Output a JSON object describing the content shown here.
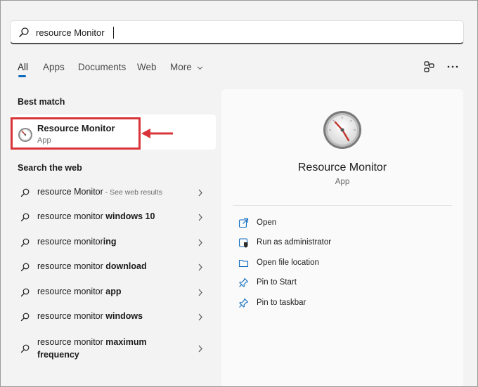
{
  "search": {
    "value": "resource Monitor"
  },
  "tabs": [
    {
      "label": "All",
      "active": true
    },
    {
      "label": "Apps"
    },
    {
      "label": "Documents"
    },
    {
      "label": "Web"
    },
    {
      "label": "More"
    }
  ],
  "toolbar": {
    "icons": [
      "share-icon",
      "more-options-icon"
    ]
  },
  "best_match": {
    "heading": "Best match",
    "title": "Resource Monitor",
    "subtitle": "App",
    "icon": "resource-monitor-gauge-icon"
  },
  "web": {
    "heading": "Search the web",
    "items": [
      {
        "prefix": "resource Monitor",
        "bold": "",
        "hint": " - See web results"
      },
      {
        "prefix": "resource monitor ",
        "bold": "windows 10",
        "hint": ""
      },
      {
        "prefix": "resource monitor",
        "bold": "ing",
        "hint": ""
      },
      {
        "prefix": "resource monitor ",
        "bold": "download",
        "hint": ""
      },
      {
        "prefix": "resource monitor ",
        "bold": "app",
        "hint": ""
      },
      {
        "prefix": "resource monitor ",
        "bold": "windows",
        "hint": ""
      },
      {
        "prefix": "resource monitor ",
        "bold": "maximum frequency",
        "hint": ""
      }
    ]
  },
  "detail": {
    "title": "Resource Monitor",
    "subtitle": "App",
    "actions": [
      {
        "label": "Open",
        "icon": "open-icon"
      },
      {
        "label": "Run as administrator",
        "icon": "shield-icon"
      },
      {
        "label": "Open file location",
        "icon": "folder-icon"
      },
      {
        "label": "Pin to Start",
        "icon": "pin-icon"
      },
      {
        "label": "Pin to taskbar",
        "icon": "pin-icon"
      }
    ]
  },
  "colors": {
    "accent": "#0e6bbf",
    "annotation_red": "#d9343a"
  }
}
